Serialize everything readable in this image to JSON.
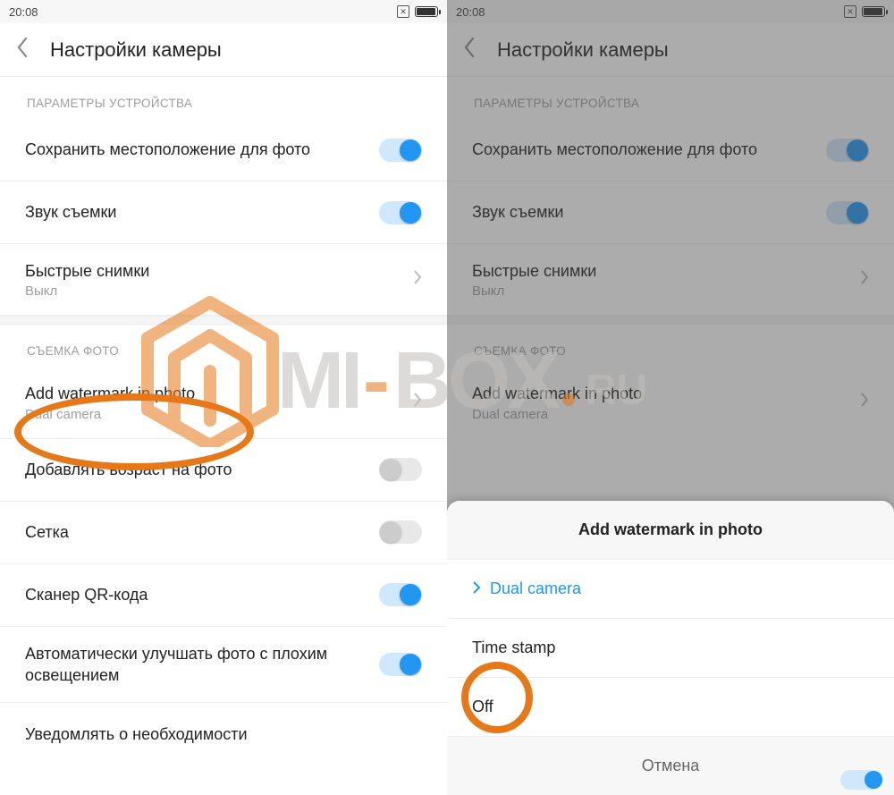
{
  "status": {
    "time": "20:08"
  },
  "header": {
    "title": "Настройки камеры"
  },
  "sections": {
    "device": {
      "title": "ПАРАМЕТРЫ УСТРОЙСТВА",
      "save_location": "Сохранить местоположение для фото",
      "shutter_sound": "Звук съемки",
      "quick_shots": {
        "label": "Быстрые снимки",
        "value": "Выкл"
      }
    },
    "photo": {
      "title": "СЪЕМКА ФОТО",
      "watermark": {
        "label": "Add watermark in photo",
        "value": "Dual camera"
      },
      "age": "Добавлять возраст на фото",
      "grid": "Сетка",
      "qr": "Сканер QR-кода",
      "auto_enhance": "Автоматически улучшать фото с плохим освещением",
      "notify": "Уведомлять о необходимости"
    }
  },
  "dialog": {
    "title": "Add watermark in photo",
    "options": {
      "dual": "Dual camera",
      "timestamp": "Time stamp",
      "off": "Off"
    },
    "cancel": "Отмена"
  },
  "watermark_site": {
    "mi": "MI",
    "dash": "-",
    "box": "BOX",
    "ru": "RU"
  }
}
